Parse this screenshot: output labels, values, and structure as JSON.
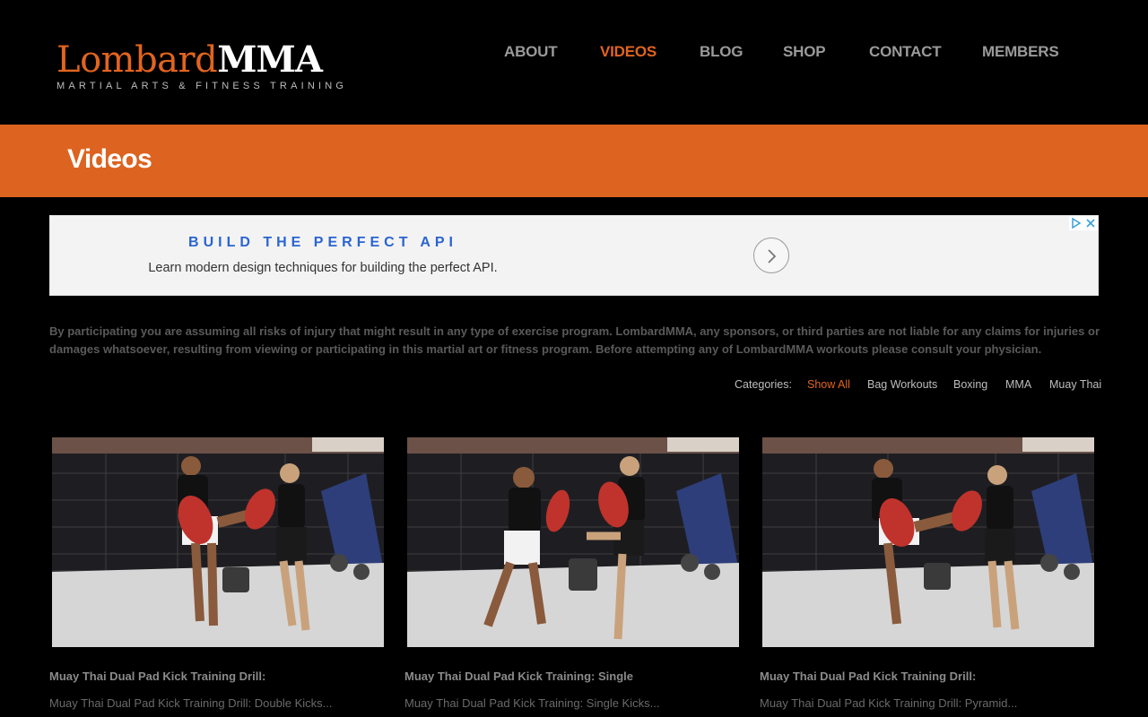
{
  "brand": {
    "name_part1": "Lombard",
    "name_part2": "MMA",
    "tagline": "MARTIAL ARTS & FITNESS TRAINING",
    "accent_color": "#e2641f"
  },
  "nav": {
    "items": [
      {
        "label": "ABOUT",
        "active": false
      },
      {
        "label": "VIDEOS",
        "active": true
      },
      {
        "label": "BLOG",
        "active": false
      },
      {
        "label": "SHOP",
        "active": false
      },
      {
        "label": "CONTACT",
        "active": false
      },
      {
        "label": "MEMBERS",
        "active": false
      }
    ]
  },
  "page": {
    "title": "Videos"
  },
  "ad": {
    "headline": "BUILD THE PERFECT API",
    "subtext": "Learn modern design techniques for building the perfect API.",
    "arrow_icon": "chevron-right-icon",
    "choices_icons": [
      "adchoices-icon",
      "close-icon"
    ]
  },
  "disclaimer": "By participating you are assuming all risks of injury that might result in any type of exercise program.  LombardMMA, any sponsors, or third parties are not liable for any claims for injuries or damages whatsoever, resulting from viewing or participating in this martial art or fitness program.  Before attempting any of LombardMMA workouts please consult your physician.",
  "categories": {
    "label": "Categories:",
    "items": [
      {
        "label": "Show All",
        "active": true
      },
      {
        "label": "Bag Workouts",
        "active": false
      },
      {
        "label": "Boxing",
        "active": false
      },
      {
        "label": "MMA",
        "active": false
      },
      {
        "label": "Muay Thai",
        "active": false
      }
    ]
  },
  "videos": [
    {
      "title": "Muay Thai Dual Pad Kick Training Drill:",
      "excerpt": "Muay Thai Dual Pad Kick Training Drill: Double Kicks..."
    },
    {
      "title": "Muay Thai Dual Pad Kick Training: Single",
      "excerpt": "Muay Thai Dual Pad Kick Training: Single Kicks..."
    },
    {
      "title": "Muay Thai Dual Pad Kick Training Drill:",
      "excerpt": "Muay Thai Dual Pad Kick Training Drill: Pyramid..."
    }
  ]
}
